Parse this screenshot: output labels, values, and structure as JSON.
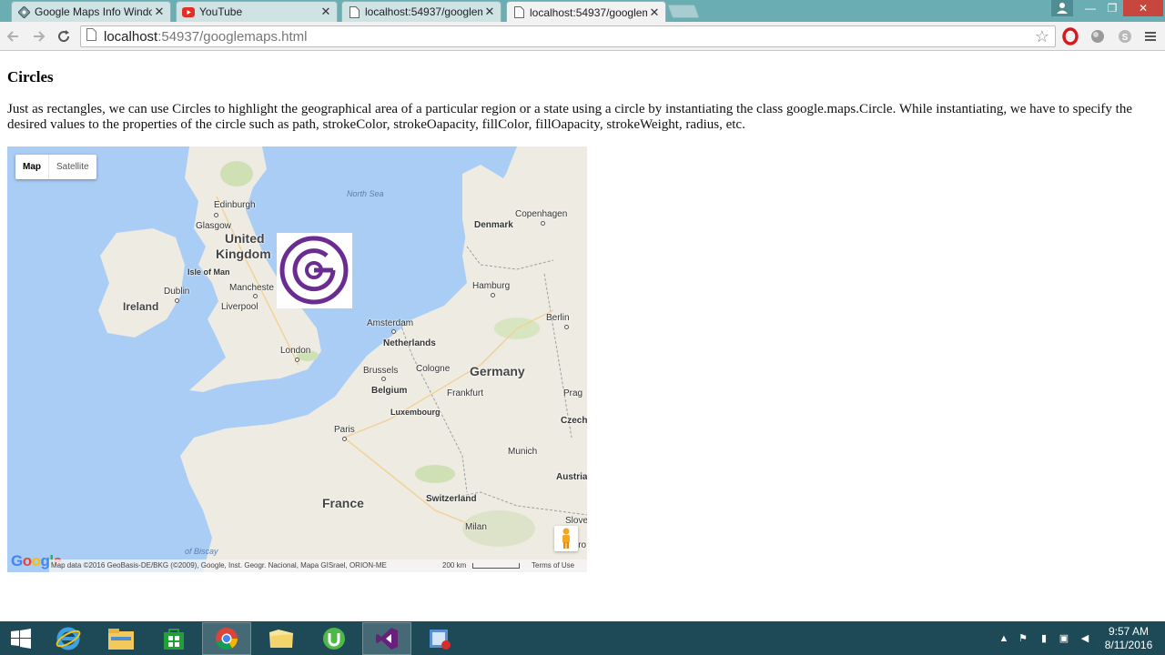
{
  "browser": {
    "tabs": [
      {
        "title": "Google Maps Info Windo",
        "icon": "maps-favicon-icon",
        "active": false
      },
      {
        "title": "YouTube",
        "icon": "youtube-favicon-icon",
        "active": false
      },
      {
        "title": "localhost:54937/googlem",
        "icon": "page-favicon-icon",
        "active": false
      },
      {
        "title": "localhost:54937/googlem",
        "icon": "page-favicon-icon",
        "active": true
      }
    ],
    "tab_close": "✕",
    "url_host": "localhost",
    "url_rest": ":54937/googlemaps.html",
    "window_buttons": {
      "minimize": "—",
      "restore": "❐",
      "close": "✕"
    }
  },
  "page": {
    "title": "Circles",
    "description": "Just as rectangles, we can use Circles to highlight the geographical area of a particular region or a state using a circle by instantiating the class google.maps.Circle. While instantiating, we have to specify the desired values to the properties of the circle such as path, strokeColor, strokeOapacity, fillColor, fillOapacity, strokeWeight, radius, etc."
  },
  "map": {
    "map_type_buttons": {
      "map": "Map",
      "satellite": "Satellite"
    },
    "labels": {
      "north_sea": "North Sea",
      "edinburgh": "Edinburgh",
      "glasgow": "Glasgow",
      "united": "United",
      "kingdom": "Kingdom",
      "isle_of_man": "Isle of Man",
      "ireland": "Ireland",
      "dublin": "Dublin",
      "manchester": "Mancheste",
      "liverpool": "Liverpool",
      "london": "London",
      "denmark": "Denmark",
      "copenhagen": "Copenhagen",
      "hamburg": "Hamburg",
      "berlin": "Berlin",
      "amsterdam": "Amsterdam",
      "netherlands": "Netherlands",
      "brussels": "Brussels",
      "cologne": "Cologne",
      "germany": "Germany",
      "belgium": "Belgium",
      "frankfurt": "Frankfurt",
      "prague": "Prag",
      "luxembourg": "Luxembourg",
      "czech": "Czech",
      "paris": "Paris",
      "munich": "Munich",
      "austria": "Austria",
      "france": "France",
      "switzerland": "Switzerland",
      "slovenia": "Slove",
      "milan": "Milan",
      "croatia": "Cro",
      "biscay": "of Biscay"
    },
    "attribution": "Map data ©2016 GeoBasis-DE/BKG (©2009), Google, Inst. Geogr. Nacional, Mapa GISrael, ORION-ME",
    "scale": "200 km",
    "terms": "Terms of Use",
    "google_logo": "Google"
  },
  "taskbar": {
    "apps": [
      "windows-start-icon",
      "internet-explorer-icon",
      "file-explorer-icon",
      "store-icon",
      "chrome-icon",
      "folder-icon",
      "utorrent-icon",
      "visual-studio-icon",
      "screen-recorder-icon"
    ],
    "time": "9:57 AM",
    "date": "8/11/2016"
  },
  "colors": {
    "tabbar": "#6aaeb4",
    "taskbar": "#1e4a57",
    "water": "#a9cdf5",
    "land": "#eeece2",
    "logo_purple": "#6a2c91"
  }
}
